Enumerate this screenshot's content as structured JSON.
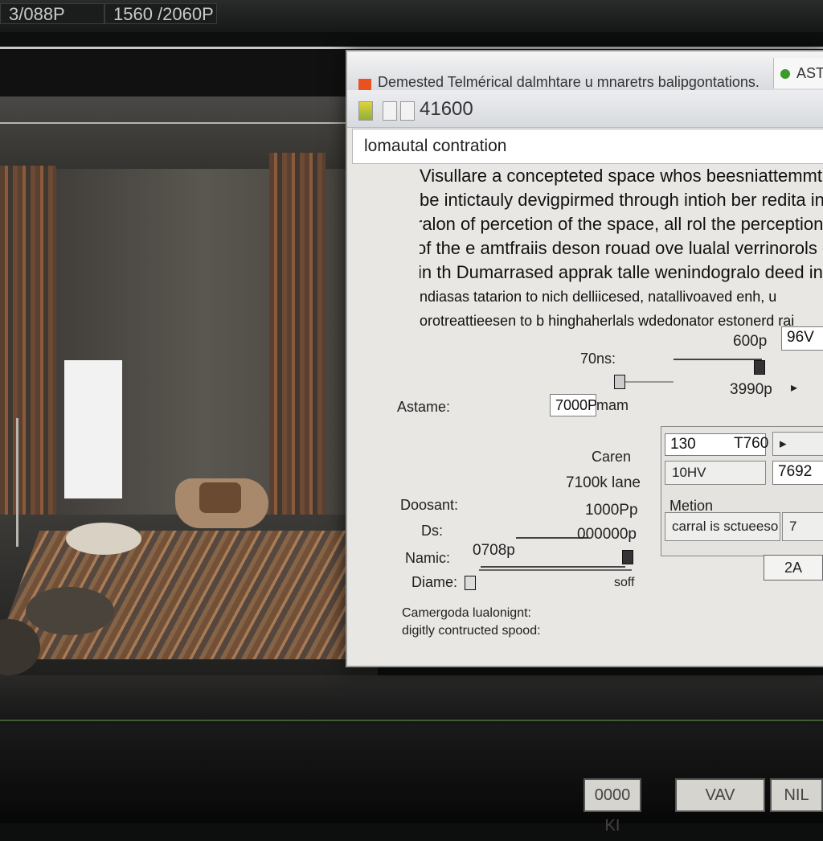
{
  "top_bar": {
    "segment_1": "3/088P",
    "segment_2": "1560 /2060P"
  },
  "dialog": {
    "title": "Demested Telmérical dalmhtare u mnaretrs balipgontations.",
    "title_right": "AST",
    "toolbar_value": "41600",
    "name_field": "lomautal contration",
    "paragraph": [
      "Visullare a concepteted space whos beesniattemmtaalee",
      "be intictauly devigpirmed through intioh ber redita in",
      "ralon of percetion of the space, all rol the perception",
      "of the e amtfraiis deson rouad ove lualal verrinorols d",
      "in th Dumarrased apprak talle wenindogralo deed ind",
      "ndiasas tatarion to nich delliicesed, natallivoaved enh, u",
      "orotreattieesen to b hinghaherlals wdedonator estonerd rai"
    ],
    "controls": {
      "label_70ns": "70ns:",
      "value_600p": "600p",
      "field_96v": "96V",
      "value_3990p": "3990p",
      "label_astame": "Astame:",
      "field_7000p": "7000P",
      "label_mam": "mam",
      "label_caren": "Caren",
      "value_7100k": "7100k lane",
      "label_doosant": "Doosant:",
      "value_1000pp": "1000Pp",
      "label_ds": "Ds:",
      "label_namic": "Namic:",
      "value_0708sp": "0708p",
      "value_000000p": "000000p",
      "label_diame": "Diame:",
      "value_soff": "soff",
      "label_camergoda": "Camergoda lualonignt:",
      "label_digitly": "digitly contructed spood:"
    },
    "panel": {
      "field_130": "130",
      "field_7760": "T760",
      "arrow_btn": "▸",
      "btn_10hv": "10HV",
      "field_7692": "7692",
      "label_metion": "Metion",
      "btn_carral": "carral is sctueeso",
      "btn_7": "7"
    },
    "ok_label": "2A"
  },
  "bottom_bar": {
    "btn_left": "0000 KI",
    "btn_mid": "VAV",
    "btn_right": "NIL"
  }
}
